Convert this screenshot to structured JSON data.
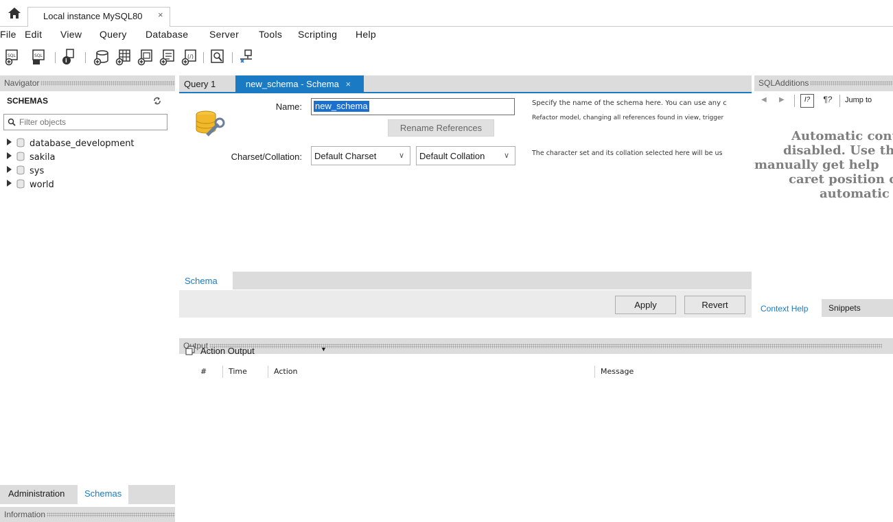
{
  "tabbar": {
    "connection_tab": "Local instance MySQL80",
    "close": "×"
  },
  "menu": [
    "File",
    "Edit",
    "View",
    "Query",
    "Database",
    "Server",
    "Tools",
    "Scripting",
    "Help"
  ],
  "toolbar": {
    "icons": [
      "new-sql-tab-icon",
      "open-sql-script-icon",
      "inspector-icon",
      "create-schema-icon",
      "create-table-icon",
      "create-view-icon",
      "create-procedure-icon",
      "create-function-icon",
      "search-table-data-icon",
      "reconnect-icon"
    ]
  },
  "navigator": {
    "header": "Navigator",
    "schemas_title": "SCHEMAS",
    "filter_placeholder": "Filter objects",
    "schemas": [
      "database_development",
      "sakila",
      "sys",
      "world"
    ],
    "tabs": {
      "administration": "Administration",
      "schemas": "Schemas"
    },
    "information_header": "Information"
  },
  "editor": {
    "tabs": {
      "query": "Query 1",
      "schema": "new_schema - Schema",
      "close": "×"
    },
    "name_label": "Name:",
    "name_value": "new_schema",
    "rename_button": "Rename References",
    "charset_label": "Charset/Collation:",
    "charset_value": "Default Charset",
    "collation_value": "Default Collation",
    "hint_name": "Specify the name of the schema here. You can use any c",
    "hint_refactor": "Refactor model, changing all references found in view, trigger",
    "hint_charset": "The character set and its collation selected here will be us",
    "bottom_tab": "Schema",
    "apply_button": "Apply",
    "revert_button": "Revert"
  },
  "sql_additions": {
    "header": "SQLAdditions",
    "jump_to": "Jump to",
    "help_lines": [
      "Automatic cont",
      "disabled. Use th",
      "manually get help",
      "caret position c",
      "automatic"
    ],
    "tabs": {
      "context_help": "Context Help",
      "snippets": "Snippets"
    }
  },
  "output": {
    "header": "Output",
    "selector": "Action Output",
    "columns": [
      "#",
      "Time",
      "Action",
      "Message"
    ]
  },
  "colors": {
    "accent": "#1a7ac4",
    "selection": "#1a6fcf",
    "panel_header": "#dcdcdc"
  }
}
